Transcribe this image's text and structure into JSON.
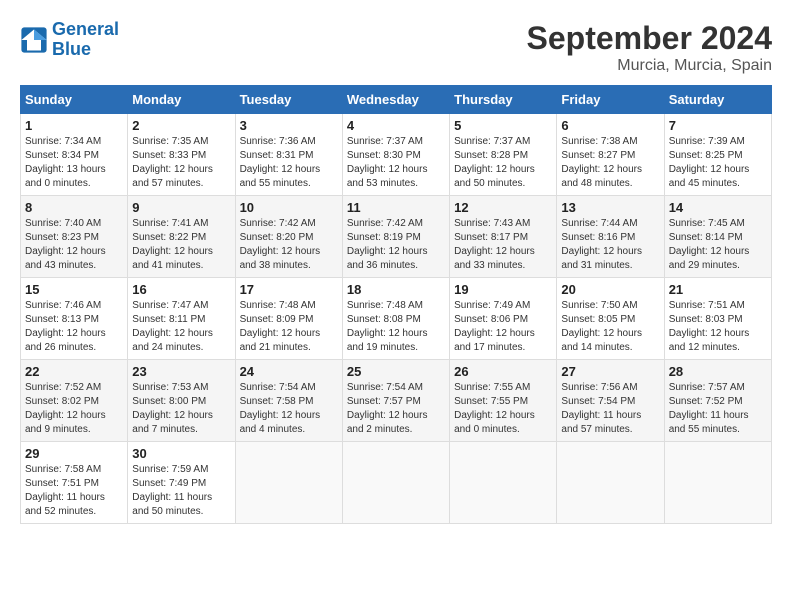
{
  "header": {
    "logo_line1": "General",
    "logo_line2": "Blue",
    "month": "September 2024",
    "location": "Murcia, Murcia, Spain"
  },
  "days_of_week": [
    "Sunday",
    "Monday",
    "Tuesday",
    "Wednesday",
    "Thursday",
    "Friday",
    "Saturday"
  ],
  "weeks": [
    [
      {
        "day": "1",
        "sunrise": "7:34 AM",
        "sunset": "8:34 PM",
        "daylight": "13 hours and 0 minutes."
      },
      {
        "day": "2",
        "sunrise": "7:35 AM",
        "sunset": "8:33 PM",
        "daylight": "12 hours and 57 minutes."
      },
      {
        "day": "3",
        "sunrise": "7:36 AM",
        "sunset": "8:31 PM",
        "daylight": "12 hours and 55 minutes."
      },
      {
        "day": "4",
        "sunrise": "7:37 AM",
        "sunset": "8:30 PM",
        "daylight": "12 hours and 53 minutes."
      },
      {
        "day": "5",
        "sunrise": "7:37 AM",
        "sunset": "8:28 PM",
        "daylight": "12 hours and 50 minutes."
      },
      {
        "day": "6",
        "sunrise": "7:38 AM",
        "sunset": "8:27 PM",
        "daylight": "12 hours and 48 minutes."
      },
      {
        "day": "7",
        "sunrise": "7:39 AM",
        "sunset": "8:25 PM",
        "daylight": "12 hours and 45 minutes."
      }
    ],
    [
      {
        "day": "8",
        "sunrise": "7:40 AM",
        "sunset": "8:23 PM",
        "daylight": "12 hours and 43 minutes."
      },
      {
        "day": "9",
        "sunrise": "7:41 AM",
        "sunset": "8:22 PM",
        "daylight": "12 hours and 41 minutes."
      },
      {
        "day": "10",
        "sunrise": "7:42 AM",
        "sunset": "8:20 PM",
        "daylight": "12 hours and 38 minutes."
      },
      {
        "day": "11",
        "sunrise": "7:42 AM",
        "sunset": "8:19 PM",
        "daylight": "12 hours and 36 minutes."
      },
      {
        "day": "12",
        "sunrise": "7:43 AM",
        "sunset": "8:17 PM",
        "daylight": "12 hours and 33 minutes."
      },
      {
        "day": "13",
        "sunrise": "7:44 AM",
        "sunset": "8:16 PM",
        "daylight": "12 hours and 31 minutes."
      },
      {
        "day": "14",
        "sunrise": "7:45 AM",
        "sunset": "8:14 PM",
        "daylight": "12 hours and 29 minutes."
      }
    ],
    [
      {
        "day": "15",
        "sunrise": "7:46 AM",
        "sunset": "8:13 PM",
        "daylight": "12 hours and 26 minutes."
      },
      {
        "day": "16",
        "sunrise": "7:47 AM",
        "sunset": "8:11 PM",
        "daylight": "12 hours and 24 minutes."
      },
      {
        "day": "17",
        "sunrise": "7:48 AM",
        "sunset": "8:09 PM",
        "daylight": "12 hours and 21 minutes."
      },
      {
        "day": "18",
        "sunrise": "7:48 AM",
        "sunset": "8:08 PM",
        "daylight": "12 hours and 19 minutes."
      },
      {
        "day": "19",
        "sunrise": "7:49 AM",
        "sunset": "8:06 PM",
        "daylight": "12 hours and 17 minutes."
      },
      {
        "day": "20",
        "sunrise": "7:50 AM",
        "sunset": "8:05 PM",
        "daylight": "12 hours and 14 minutes."
      },
      {
        "day": "21",
        "sunrise": "7:51 AM",
        "sunset": "8:03 PM",
        "daylight": "12 hours and 12 minutes."
      }
    ],
    [
      {
        "day": "22",
        "sunrise": "7:52 AM",
        "sunset": "8:02 PM",
        "daylight": "12 hours and 9 minutes."
      },
      {
        "day": "23",
        "sunrise": "7:53 AM",
        "sunset": "8:00 PM",
        "daylight": "12 hours and 7 minutes."
      },
      {
        "day": "24",
        "sunrise": "7:54 AM",
        "sunset": "7:58 PM",
        "daylight": "12 hours and 4 minutes."
      },
      {
        "day": "25",
        "sunrise": "7:54 AM",
        "sunset": "7:57 PM",
        "daylight": "12 hours and 2 minutes."
      },
      {
        "day": "26",
        "sunrise": "7:55 AM",
        "sunset": "7:55 PM",
        "daylight": "12 hours and 0 minutes."
      },
      {
        "day": "27",
        "sunrise": "7:56 AM",
        "sunset": "7:54 PM",
        "daylight": "11 hours and 57 minutes."
      },
      {
        "day": "28",
        "sunrise": "7:57 AM",
        "sunset": "7:52 PM",
        "daylight": "11 hours and 55 minutes."
      }
    ],
    [
      {
        "day": "29",
        "sunrise": "7:58 AM",
        "sunset": "7:51 PM",
        "daylight": "11 hours and 52 minutes."
      },
      {
        "day": "30",
        "sunrise": "7:59 AM",
        "sunset": "7:49 PM",
        "daylight": "11 hours and 50 minutes."
      },
      null,
      null,
      null,
      null,
      null
    ]
  ]
}
